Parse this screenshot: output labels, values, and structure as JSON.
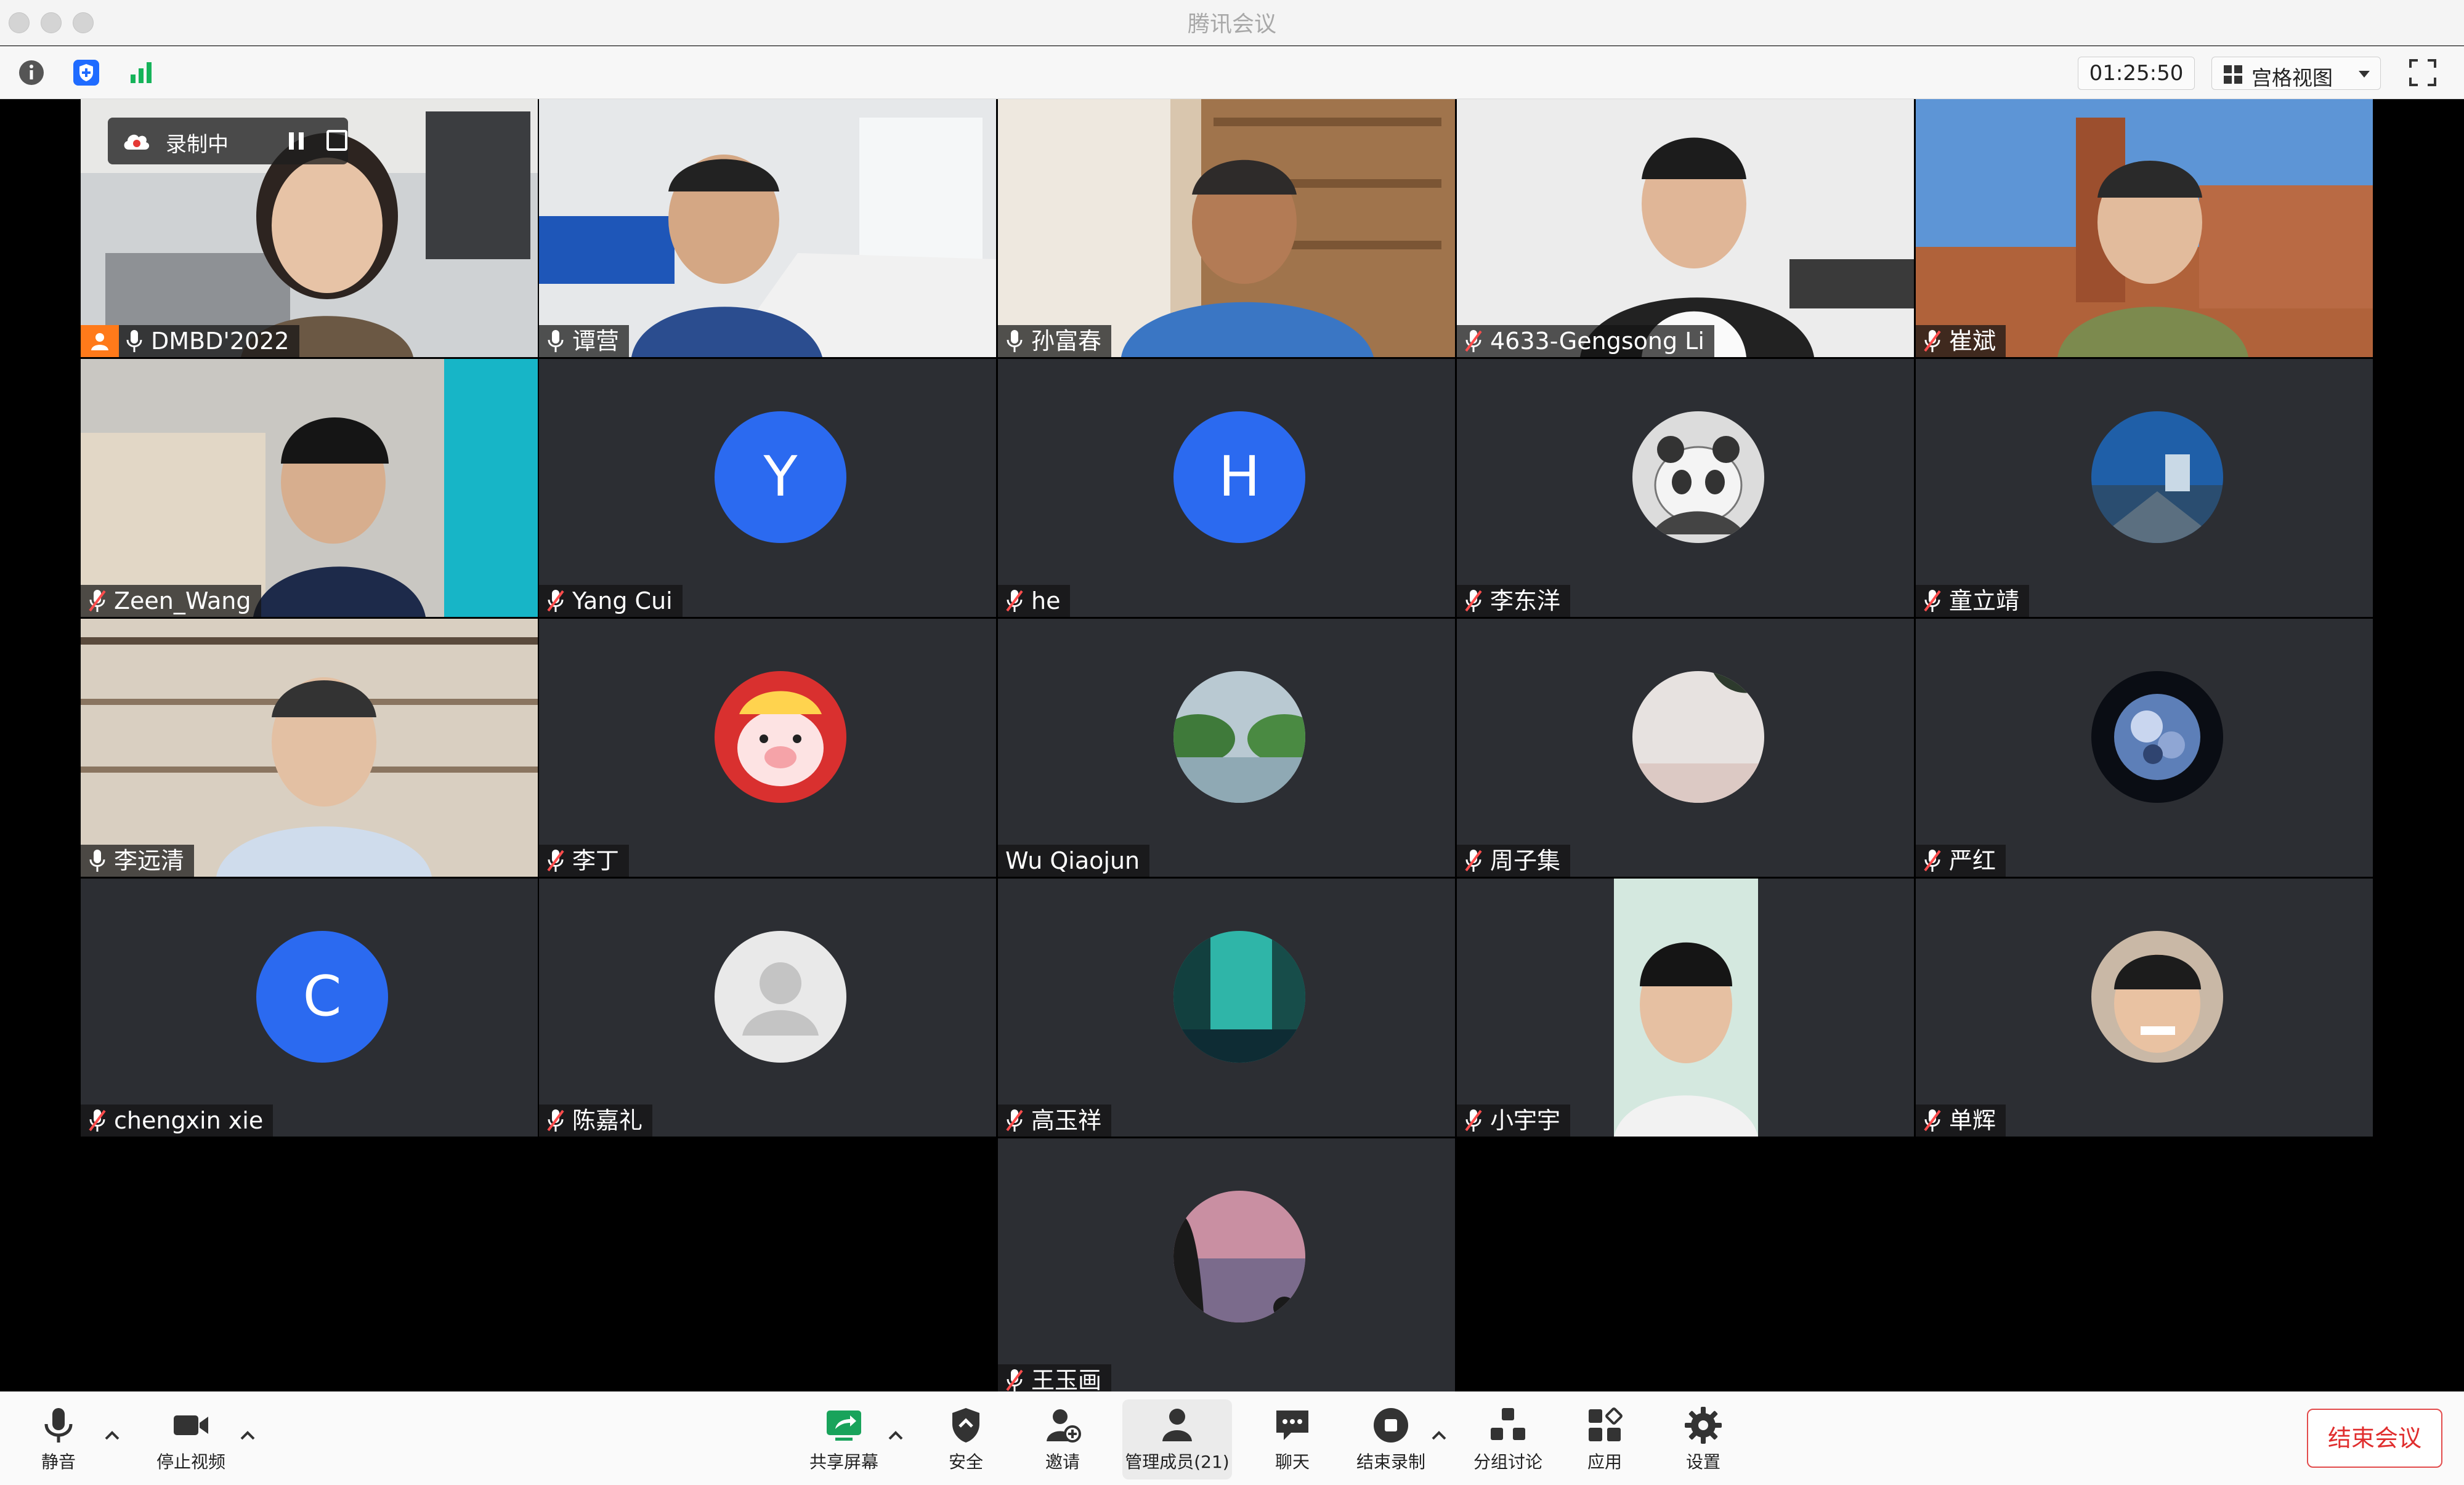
{
  "window": {
    "title": "腾讯会议"
  },
  "statusbar": {
    "timer": "01:25:50",
    "view_mode": "宫格视图"
  },
  "recording": {
    "label": "录制中"
  },
  "participants": [
    {
      "name": "DMBD'2022",
      "host": true,
      "mic": "on",
      "kind": "video"
    },
    {
      "name": "谭营",
      "mic": "on",
      "kind": "video"
    },
    {
      "name": "孙富春",
      "mic": "on",
      "kind": "video"
    },
    {
      "name": "4633-Gengsong Li",
      "mic": "off",
      "kind": "video"
    },
    {
      "name": "崔斌",
      "mic": "off",
      "kind": "video"
    },
    {
      "name": "Zeen_Wang",
      "mic": "off",
      "kind": "video"
    },
    {
      "name": "Yang Cui",
      "mic": "off",
      "kind": "letter",
      "letter": "Y"
    },
    {
      "name": "he",
      "mic": "off",
      "kind": "letter",
      "letter": "H"
    },
    {
      "name": "李东洋",
      "mic": "off",
      "kind": "avatar"
    },
    {
      "name": "童立靖",
      "mic": "off",
      "kind": "avatar"
    },
    {
      "name": "李远清",
      "mic": "on",
      "kind": "video"
    },
    {
      "name": "李丁",
      "mic": "off",
      "kind": "avatar"
    },
    {
      "name": "Wu Qiaojun",
      "mic": "none",
      "kind": "avatar"
    },
    {
      "name": "周子集",
      "mic": "off",
      "kind": "avatar"
    },
    {
      "name": "严红",
      "mic": "off",
      "kind": "avatar"
    },
    {
      "name": "chengxin xie",
      "mic": "off",
      "kind": "letter",
      "letter": "C"
    },
    {
      "name": "陈嘉礼",
      "mic": "off",
      "kind": "avatar"
    },
    {
      "name": "高玉祥",
      "mic": "off",
      "kind": "avatar"
    },
    {
      "name": "小宇宇",
      "mic": "off",
      "kind": "video"
    },
    {
      "name": "单辉",
      "mic": "off",
      "kind": "avatar"
    },
    {
      "name": "王玉画",
      "mic": "off",
      "kind": "avatar"
    }
  ],
  "toolbar": {
    "mute": "静音",
    "stop_video": "停止视频",
    "share_screen": "共享屏幕",
    "security": "安全",
    "invite": "邀请",
    "manage_members": "管理成员(21)",
    "chat": "聊天",
    "end_recording": "结束录制",
    "breakout": "分组讨论",
    "apps": "应用",
    "settings": "设置",
    "end_meeting": "结束会议"
  },
  "colors": {
    "tile_bg": "#2c2e33",
    "avatar_blue": "#2b6af0",
    "host_orange": "#ff7a1a",
    "end_red": "#e02e2e",
    "mic_muted_red": "#ff4d4d"
  }
}
